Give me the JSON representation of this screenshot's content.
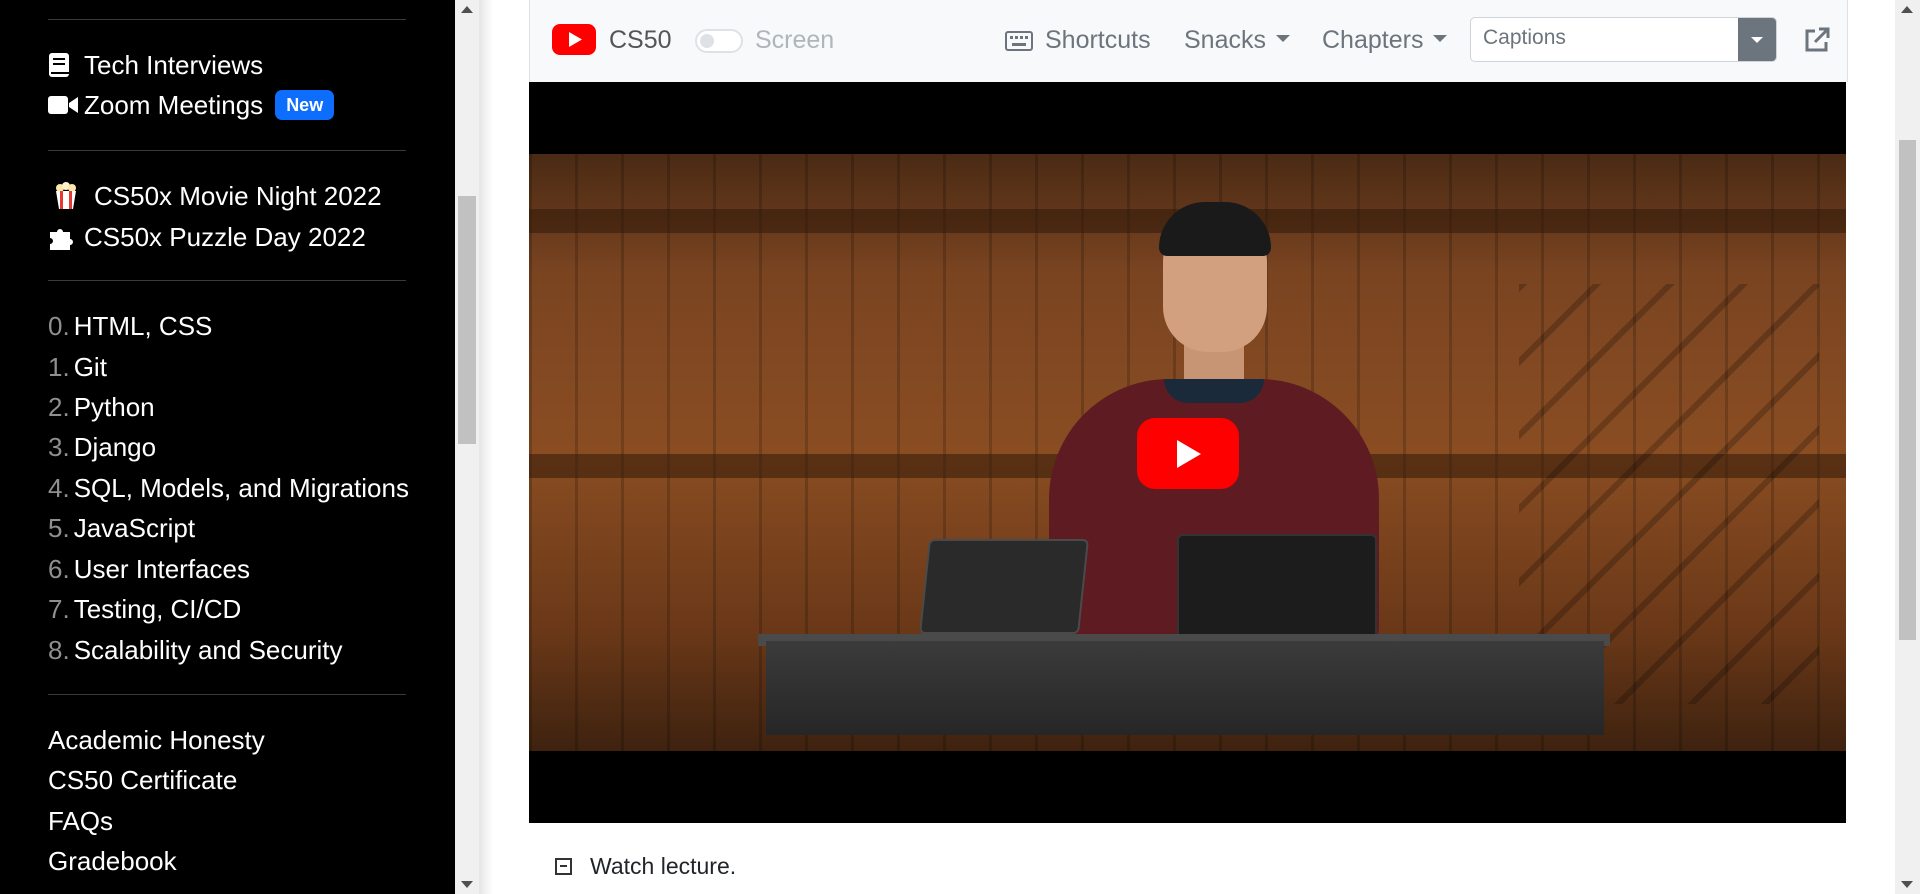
{
  "sidebar": {
    "section1": [
      {
        "icon": "book-icon",
        "label": "Tech Interviews"
      },
      {
        "icon": "video-camera-icon",
        "label": "Zoom Meetings",
        "badge": "New"
      }
    ],
    "section2": [
      {
        "icon": "popcorn-icon",
        "label": "CS50x Movie Night 2022"
      },
      {
        "icon": "puzzle-icon",
        "label": "CS50x Puzzle Day 2022"
      }
    ],
    "lectures": [
      {
        "num": "0.",
        "label": "HTML, CSS"
      },
      {
        "num": "1.",
        "label": "Git"
      },
      {
        "num": "2.",
        "label": "Python"
      },
      {
        "num": "3.",
        "label": "Django"
      },
      {
        "num": "4.",
        "label": "SQL, Models, and Migrations"
      },
      {
        "num": "5.",
        "label": "JavaScript"
      },
      {
        "num": "6.",
        "label": "User Interfaces"
      },
      {
        "num": "7.",
        "label": "Testing, CI/CD"
      },
      {
        "num": "8.",
        "label": "Scalability and Security"
      }
    ],
    "links": [
      "Academic Honesty",
      "CS50 Certificate",
      "FAQs",
      "Gradebook"
    ]
  },
  "toolbar": {
    "youtube_icon": "youtube-icon",
    "title": "CS50",
    "screen_label": "Screen",
    "shortcuts_label": "Shortcuts",
    "snacks_label": "Snacks",
    "chapters_label": "Chapters",
    "captions_value": "Captions",
    "popout_icon": "external-link-icon"
  },
  "video": {
    "play_icon": "youtube-play-icon"
  },
  "content": {
    "watch_label": "Watch lecture."
  },
  "colors": {
    "sidebar_bg": "#000000",
    "badge": "#0d6efd",
    "youtube_red": "#ff0000",
    "toolbar_bg": "#f8f9fa"
  }
}
